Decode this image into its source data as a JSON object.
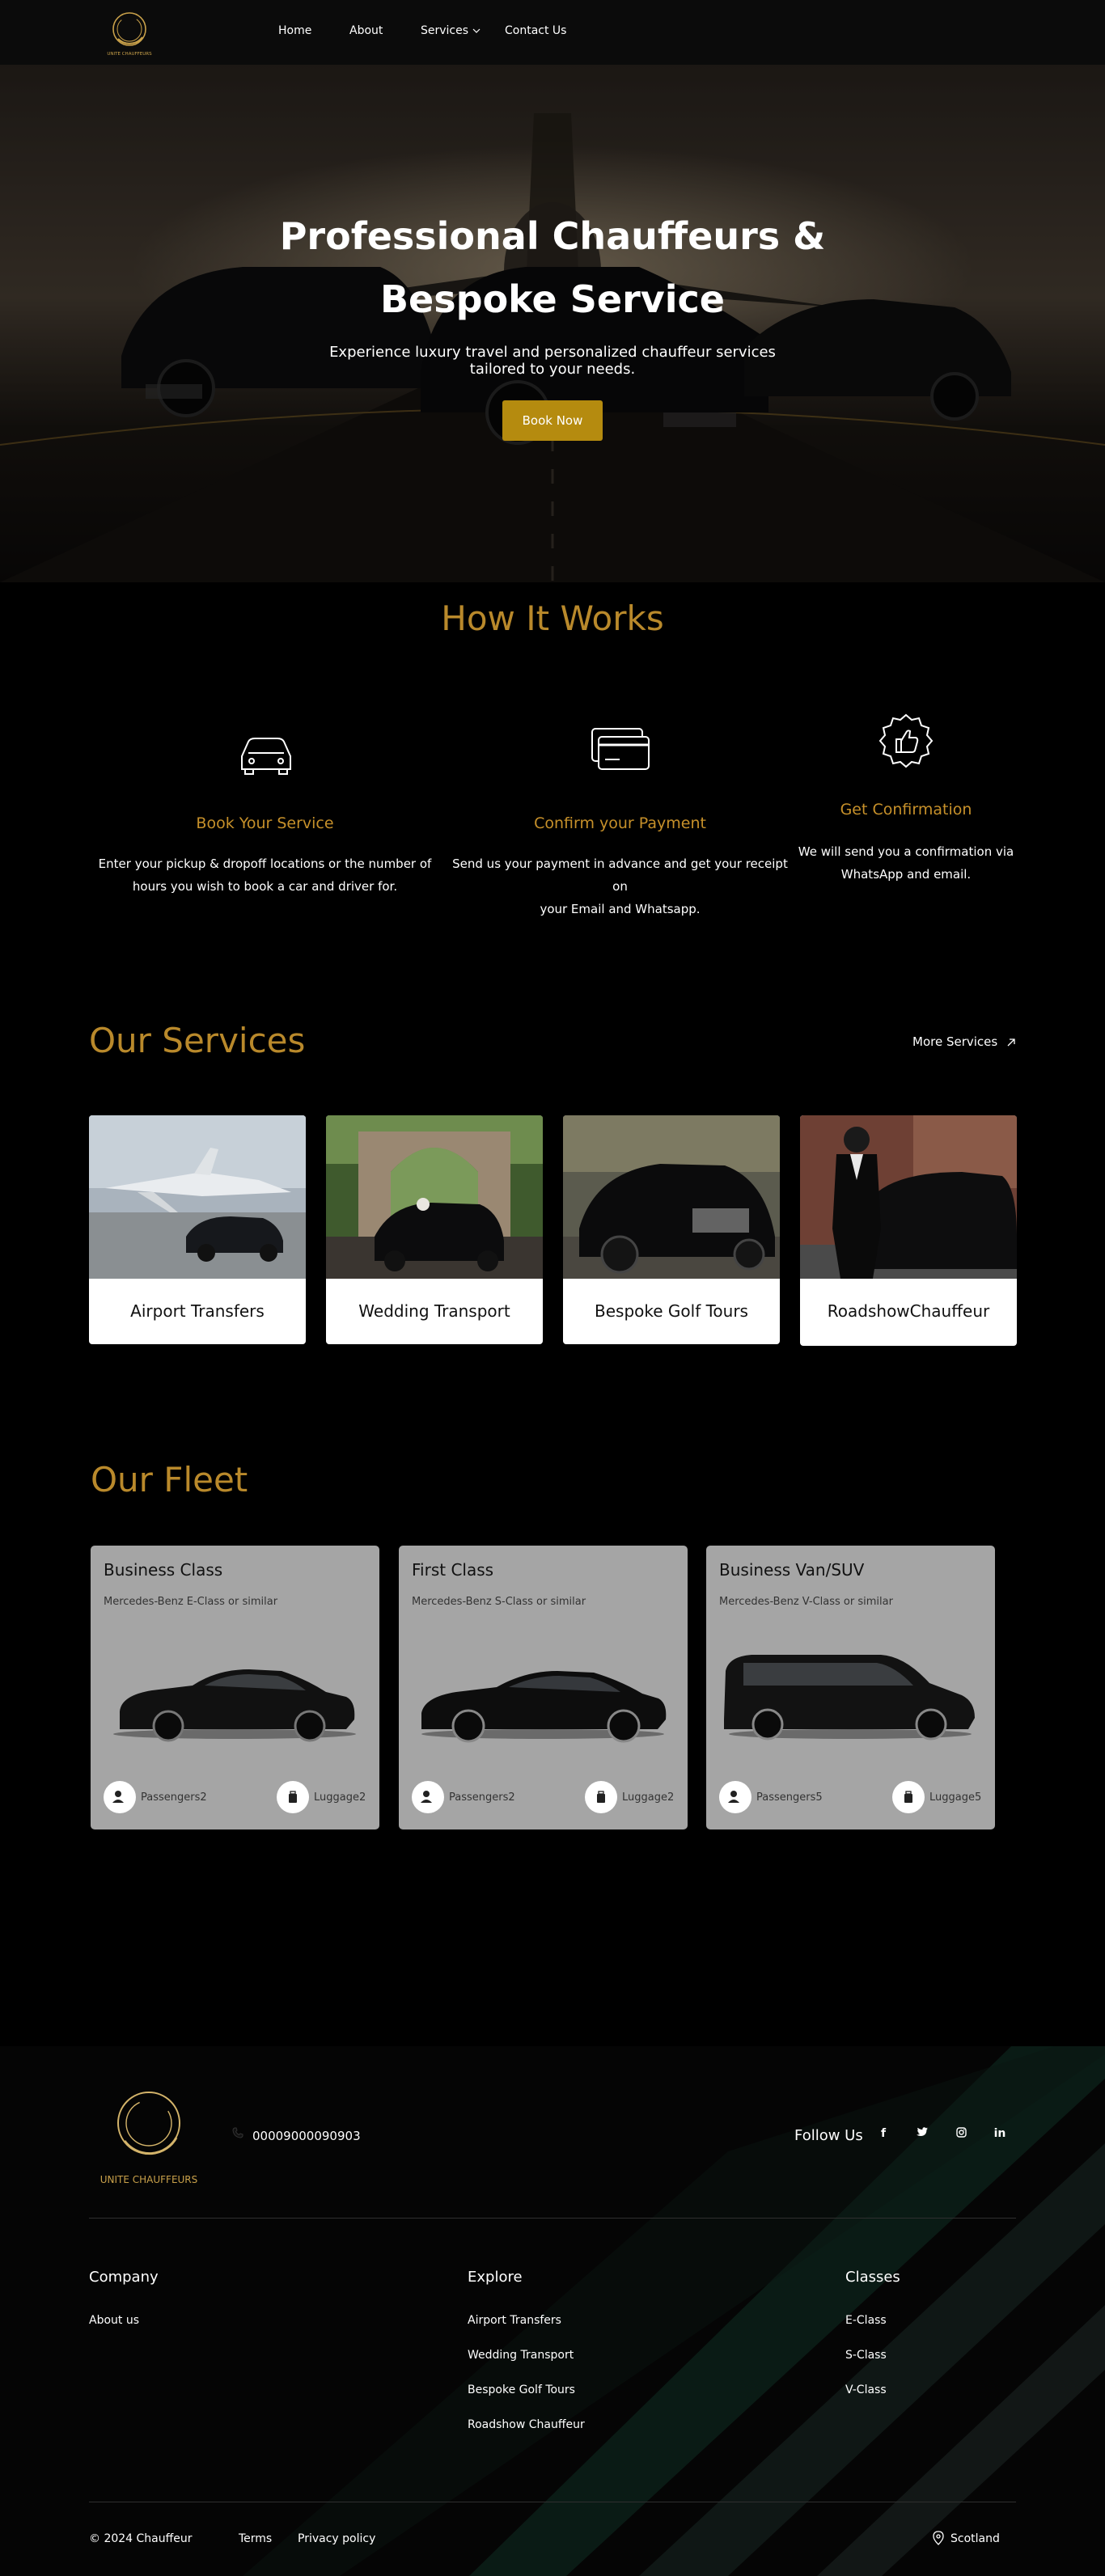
{
  "brand": {
    "logo_text": "UNITE CHAUFFEURS",
    "accent": "#b58b0f",
    "heading_color": "#b9892b"
  },
  "nav": {
    "items": [
      {
        "label": "Home"
      },
      {
        "label": "About"
      },
      {
        "label": "Services"
      },
      {
        "label": "Contact Us"
      }
    ],
    "dropdown_icon": "chevron-down-icon"
  },
  "hero": {
    "title_line1": "Professional Chauffeurs &",
    "title_line2": "Bespoke Service",
    "subtitle_line1": "Experience luxury travel and personalized chauffeur services",
    "subtitle_line2": "tailored to your needs.",
    "button": "Book Now"
  },
  "how_it_works": {
    "title": "How It Works",
    "steps": [
      {
        "icon": "car-icon",
        "title": "Book Your Service",
        "text_line1": "Enter your pickup & dropoff locations or the number of",
        "text_line2": "hours you wish to book a car and driver for."
      },
      {
        "icon": "credit-card-icon",
        "title": "Confirm your Payment",
        "text_line1": "Send us your payment in advance and get your receipt on",
        "text_line2": "your Email and Whatsapp."
      },
      {
        "icon": "thumbs-up-badge-icon",
        "title": "Get Confirmation",
        "text_line1": "We will send you a confirmation via",
        "text_line2": "WhatsApp and email."
      }
    ]
  },
  "services": {
    "title": "Our Services",
    "more_link": "More Services",
    "more_icon": "arrow-up-right-icon",
    "cards": [
      {
        "label": "Airport Transfers"
      },
      {
        "label": "Wedding Transport"
      },
      {
        "label": "Bespoke Golf Tours"
      },
      {
        "label": "RoadshowChauffeur"
      }
    ]
  },
  "fleet": {
    "title": "Our Fleet",
    "cards": [
      {
        "name": "Business Class",
        "model": "Mercedes-Benz E-Class or similar",
        "passengers": "Passengers2",
        "luggage": "Luggage2"
      },
      {
        "name": "First Class",
        "model": "Mercedes-Benz S-Class or similar",
        "passengers": "Passengers2",
        "luggage": "Luggage2"
      },
      {
        "name": "Business Van/SUV",
        "model": "Mercedes-Benz V-Class or similar",
        "passengers": "Passengers5",
        "luggage": "Luggage5"
      }
    ]
  },
  "footer": {
    "logo_text": "UNITE CHAUFFEURS",
    "phone": "00009000090903",
    "follow": "Follow Us",
    "socials": [
      {
        "icon": "facebook-icon",
        "glyph": "f"
      },
      {
        "icon": "twitter-icon",
        "glyph": "t"
      },
      {
        "icon": "instagram-icon",
        "glyph": "◎"
      },
      {
        "icon": "linkedin-icon",
        "glyph": "in"
      }
    ],
    "company": {
      "title": "Company",
      "links": [
        "About us"
      ]
    },
    "explore": {
      "title": "Explore",
      "links": [
        "Airport Transfers",
        "Wedding Transport",
        "Bespoke Golf Tours",
        "Roadshow Chauffeur"
      ]
    },
    "classes": {
      "title": "Classes",
      "links": [
        "E-Class",
        "S-Class",
        "V-Class"
      ]
    },
    "copyright": "© 2024 Chauffeur",
    "terms": "Terms",
    "privacy": "Privacy policy",
    "location": "Scotland"
  }
}
